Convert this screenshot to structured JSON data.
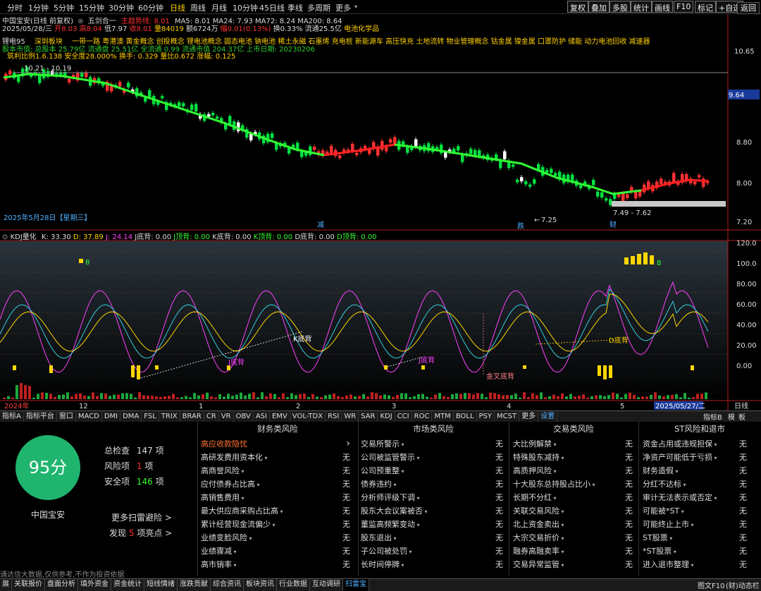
{
  "top_toolbar": {
    "periods": [
      "分时",
      "1分钟",
      "5分钟",
      "15分钟",
      "30分钟",
      "60分钟",
      "日线",
      "周线",
      "月线",
      "10分钟",
      "45日线",
      "季线",
      "多周期",
      "更多"
    ],
    "active_period": "日线",
    "right_buttons": [
      "复权",
      "叠加",
      "多股",
      "统计",
      "画线",
      "F10",
      "标记",
      "+自选",
      "返回"
    ]
  },
  "chart_header": {
    "stock_name": "中国宝安(日线 前复权)",
    "indicator_name": "五剑合一",
    "main_label": "主趋势线: 8.01",
    "ma5": "MA5: 8.01",
    "ma24": "MA24: 7.93",
    "ma72": "MA72: 8.24",
    "ma200": "MA200: 8.64",
    "line2_date": "2025/05/28/三",
    "line2_open": "开8.03",
    "line2_high": "高8.04",
    "line2_low": "低7.97",
    "line2_close": "收8.01",
    "line2_vol": "量84019",
    "line2_amt": "额6724万",
    "line2_chg": "幅0.01(0.13%)",
    "line2_turn": "换0.33%",
    "line2_float": "流通25.5亿",
    "line2_industry": "电池化学品",
    "concept_prefix": "锂电95",
    "concept_label": "深圳板块",
    "concepts": "一带一路 粤港澳 黄金概念 创投概念 锂电池概念 固态电池 钠电池 稀土永磁 石墨烯 充电桩 新能源车 高压快充 土地流转 物业管理概念 钴金属 镍金属 口罩防护 储能 动力电池回收 减速器",
    "capital_line": "股本市值: 总股本 25.79亿 流通盘 25.51亿 全流通 0.99 流通市值 204.37亿 上市日期: 20230206",
    "stats_line": "筑利比例1.6.138  安全度28.000%  换手: 0.329  量比0.672  涨幅: 0.125",
    "price_note_high": "10.21 - 10.19",
    "price_note_low": "7.49 - 7.62",
    "min_price": "7.25",
    "date_label": "2025年5月28日【星期三】",
    "marker_1": "减",
    "marker_2": "跌",
    "marker_3": "财"
  },
  "price_axis": {
    "ticks": [
      "10.65",
      "9.64",
      "8.80",
      "8.00",
      "7.20"
    ],
    "current_price": "9.64"
  },
  "kdj": {
    "title": "KDJ量化",
    "k": "K: 33.30",
    "d": "D: 37.89",
    "j": "J: 24.14",
    "j_bottom": "J底背: 0.00",
    "j_top": "J顶背: 0.00",
    "k_bottom": "K底背: 0.00",
    "k_top": "K顶背: 0.00",
    "d_bottom": "D底背: 0.00",
    "d_top": "D顶背: 0.00",
    "axis_ticks": [
      "120.0",
      "100.0",
      "80.00",
      "60.00",
      "40.00",
      "20.00",
      "0.00"
    ],
    "annotations": [
      "K底背",
      "J底背",
      "J底背",
      "金叉底背",
      "D底背",
      "8",
      "8"
    ]
  },
  "time_axis": {
    "labels": [
      "2024年",
      "12",
      "1",
      "2",
      "3",
      "4",
      "5",
      "2025/05/27/二"
    ],
    "right_label": "日线"
  },
  "indicator_tabs": [
    "指标A",
    "指标平台",
    "窗口",
    "MACD",
    "DMI",
    "DMA",
    "FSL",
    "TRIX",
    "BRAR",
    "CR",
    "VR",
    "OBV",
    "ASI",
    "EMV",
    "VOL-TDX",
    "RSI",
    "WR",
    "SAR",
    "KDJ",
    "CCI",
    "ROC",
    "MTM",
    "BOLL",
    "PSY",
    "MCST",
    "更多",
    "设置"
  ],
  "indicator_tabs_right": [
    "指标B",
    "模",
    "板"
  ],
  "score_panel": {
    "score": "95分",
    "checked_label": "总检查",
    "checked_value": "147",
    "risk_label": "风险项",
    "risk_value": "1",
    "safe_label": "安全项",
    "safe_value": "146",
    "unit": "项",
    "stock": "中国宝安",
    "more": "更多扫雷避险 >",
    "found_prefix": "发现",
    "found_value": "5",
    "found_suffix": "项亮点 >",
    "disclaimer": "通达信大数据,仅供参考,不作为投资依据"
  },
  "risk_categories": [
    {
      "title": "财务类风险",
      "items": [
        {
          "name": "高应收款隐忧",
          "value": "",
          "highlight": true
        },
        {
          "name": "高研发费用资本化",
          "value": "无"
        },
        {
          "name": "高商誉风险",
          "value": "无"
        },
        {
          "name": "应付债券占比高",
          "value": "无"
        },
        {
          "name": "高销售费用",
          "value": "无"
        },
        {
          "name": "最大供应商采购占比高",
          "value": "无"
        },
        {
          "name": "累计经营现金流偏少",
          "value": "无"
        },
        {
          "name": "业绩变脸风险",
          "value": "无"
        },
        {
          "name": "业绩骤减",
          "value": "无"
        },
        {
          "name": "高市销率",
          "value": "无"
        }
      ]
    },
    {
      "title": "市场类风险",
      "items": [
        {
          "name": "交易所警示",
          "value": "无"
        },
        {
          "name": "公司被监管警示",
          "value": "无"
        },
        {
          "name": "公司预重整",
          "value": "无"
        },
        {
          "name": "债券违约",
          "value": "无"
        },
        {
          "name": "分析师评级下调",
          "value": "无"
        },
        {
          "name": "股东大会议案被否",
          "value": "无"
        },
        {
          "name": "董监高频繁变动",
          "value": "无"
        },
        {
          "name": "股东退出",
          "value": "无"
        },
        {
          "name": "子公司被处罚",
          "value": "无"
        },
        {
          "name": "长时间停牌",
          "value": "无"
        }
      ]
    },
    {
      "title": "交易类风险",
      "items": [
        {
          "name": "大比例解禁",
          "value": "无"
        },
        {
          "name": "特殊股东减持",
          "value": "无"
        },
        {
          "name": "高质押风险",
          "value": "无"
        },
        {
          "name": "十大股东总持股占比小",
          "value": "无"
        },
        {
          "name": "长期不分红",
          "value": "无"
        },
        {
          "name": "关联交易风险",
          "value": "无"
        },
        {
          "name": "北上资金卖出",
          "value": "无"
        },
        {
          "name": "大宗交易折价",
          "value": "无"
        },
        {
          "name": "融券高融卖率",
          "value": "无"
        },
        {
          "name": "交易异常监管",
          "value": "无"
        }
      ]
    },
    {
      "title": "ST风险和退市",
      "items": [
        {
          "name": "资金占用或违规担保",
          "value": "无"
        },
        {
          "name": "净资产可能低于亏损",
          "value": "无"
        },
        {
          "name": "财务造假",
          "value": "无"
        },
        {
          "name": "分红不达标",
          "value": "无"
        },
        {
          "name": "审计无法表示或否定",
          "value": "无"
        },
        {
          "name": "可能被*ST",
          "value": "无"
        },
        {
          "name": "可能终止上市",
          "value": "无"
        },
        {
          "name": "ST股票",
          "value": "无"
        },
        {
          "name": "*ST股票",
          "value": "无"
        },
        {
          "name": "进入退市整理",
          "value": "无"
        }
      ]
    }
  ],
  "status_bar": [
    "展",
    "关联报价",
    "盘面分析",
    "填外资金",
    "资金统计",
    "短线情绪",
    "涨跌贡献",
    "综合资讯",
    "板块资讯",
    "行业数据",
    "互动调研",
    "扫雷宝"
  ],
  "status_right": [
    "图文F10",
    "(财)动态栏"
  ],
  "colors": {
    "up": "#ff3030",
    "down": "#00e040",
    "trend_green": "#33ff33",
    "trend_red": "#ff2020",
    "k_line": "#ffffff",
    "d_line": "#ffd700",
    "j_line": "#ff40ff",
    "cyan_line": "#33d0e0",
    "score_green": "#1fb56e"
  }
}
